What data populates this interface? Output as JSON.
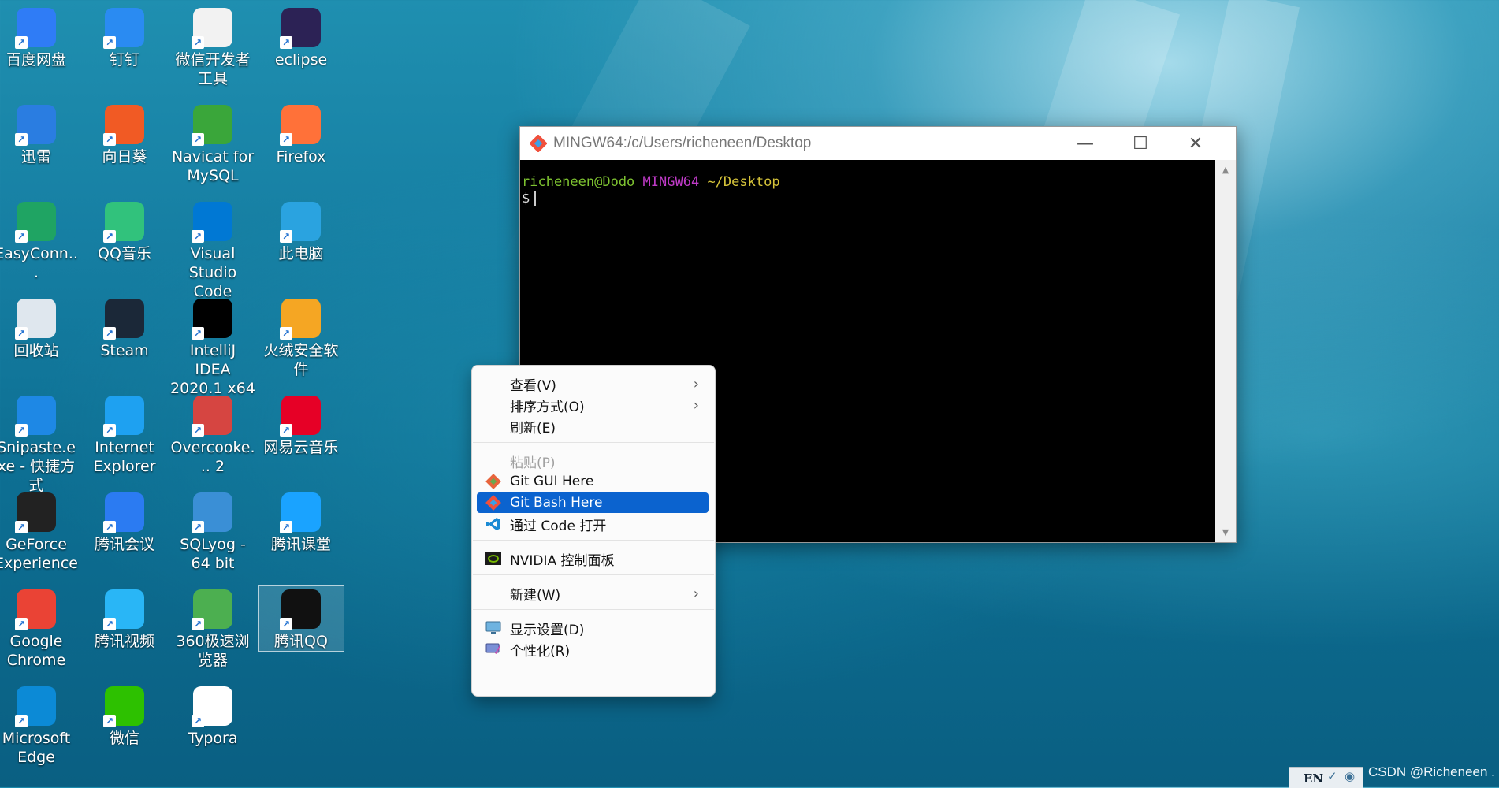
{
  "desktop": {
    "icons": [
      {
        "label": "百度网盘",
        "icon": "baidu-netdisk-icon",
        "color": "#2f7cf6"
      },
      {
        "label": "钉钉",
        "icon": "dingtalk-icon",
        "color": "#2a8bf2"
      },
      {
        "label": "微信开发者工具",
        "icon": "wechat-devtools-icon",
        "color": "#f2f2f2"
      },
      {
        "label": "eclipse",
        "icon": "eclipse-icon",
        "color": "#2c2255"
      },
      {
        "label": "迅雷",
        "icon": "xunlei-icon",
        "color": "#2a7de1"
      },
      {
        "label": "向日葵",
        "icon": "sunlogin-icon",
        "color": "#f15a24"
      },
      {
        "label": "Navicat for MySQL",
        "icon": "navicat-icon",
        "color": "#3aa63a"
      },
      {
        "label": "Firefox",
        "icon": "firefox-icon",
        "color": "#ff7139"
      },
      {
        "label": "EasyConn...",
        "icon": "easyconnect-icon",
        "color": "#1fa463"
      },
      {
        "label": "QQ音乐",
        "icon": "qqmusic-icon",
        "color": "#31c27c"
      },
      {
        "label": "Visual Studio Code",
        "icon": "vscode-icon",
        "color": "#0078d4"
      },
      {
        "label": "此电脑",
        "icon": "this-pc-icon",
        "color": "#2aa3e0"
      },
      {
        "label": "回收站",
        "icon": "recycle-bin-icon",
        "color": "#dfe7ee"
      },
      {
        "label": "Steam",
        "icon": "steam-icon",
        "color": "#1b2838"
      },
      {
        "label": "IntelliJ IDEA 2020.1 x64",
        "icon": "intellij-icon",
        "color": "#000000"
      },
      {
        "label": "火绒安全软件",
        "icon": "huorong-icon",
        "color": "#f5a623"
      },
      {
        "label": "Snipaste.exe - 快捷方式",
        "icon": "snipaste-icon",
        "color": "#1e88e5"
      },
      {
        "label": "Internet Explorer",
        "icon": "internet-explorer-icon",
        "color": "#1ea1f1"
      },
      {
        "label": "Overcooke... 2",
        "icon": "overcooked-icon",
        "color": "#d64541"
      },
      {
        "label": "网易云音乐",
        "icon": "netease-music-icon",
        "color": "#e60026"
      },
      {
        "label": "GeForce Experience",
        "icon": "geforce-icon",
        "color": "#222222"
      },
      {
        "label": "腾讯会议",
        "icon": "tencent-meeting-icon",
        "color": "#2b7bf2"
      },
      {
        "label": "SQLyog - 64 bit",
        "icon": "sqlyog-icon",
        "color": "#3a8fd6"
      },
      {
        "label": "腾讯课堂",
        "icon": "tencent-classroom-icon",
        "color": "#1aa3ff"
      },
      {
        "label": "Google Chrome",
        "icon": "chrome-icon",
        "color": "#ea4335"
      },
      {
        "label": "腾讯视频",
        "icon": "tencent-video-icon",
        "color": "#29b6f6"
      },
      {
        "label": "360极速浏览器",
        "icon": "360-browser-icon",
        "color": "#4caf50"
      },
      {
        "label": "腾讯QQ",
        "icon": "qq-icon",
        "color": "#111111"
      },
      {
        "label": "Microsoft Edge",
        "icon": "edge-icon",
        "color": "#0c8ad6"
      },
      {
        "label": "微信",
        "icon": "wechat-icon",
        "color": "#2dc100"
      },
      {
        "label": "Typora",
        "icon": "typora-icon",
        "color": "#ffffff"
      }
    ]
  },
  "terminal": {
    "title": "MINGW64:/c/Users/richeneen/Desktop",
    "prompt_user": "richeneen@Dodo",
    "prompt_env": "MINGW64",
    "prompt_path": "~/Desktop",
    "prompt_symbol": "$"
  },
  "context_menu": {
    "view": "查看(V)",
    "sort": "排序方式(O)",
    "refresh": "刷新(E)",
    "paste": "粘贴(P)",
    "git_gui": "Git GUI Here",
    "git_bash": "Git Bash Here",
    "open_code": "通过 Code 打开",
    "nvidia": "NVIDIA 控制面板",
    "new": "新建(W)",
    "display": "显示设置(D)",
    "personalize": "个性化(R)"
  },
  "tray": {
    "lang": "EN"
  },
  "watermark": "CSDN @Richeneen ."
}
